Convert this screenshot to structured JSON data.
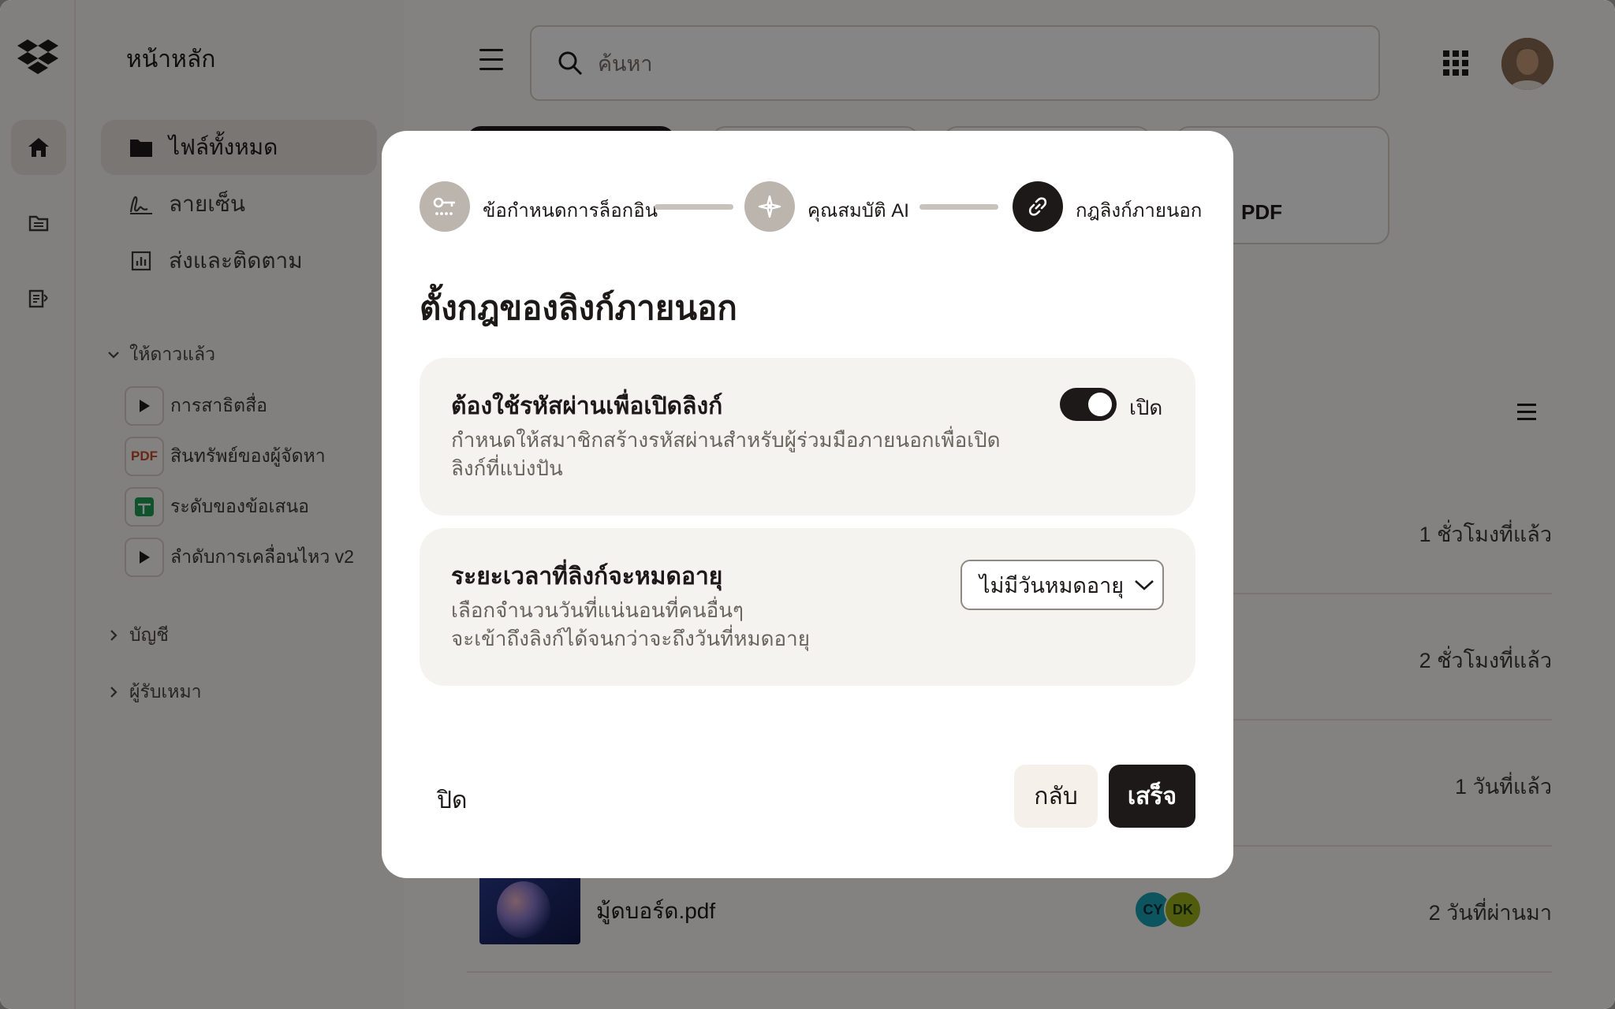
{
  "sidebar": {
    "title": "หน้าหลัก",
    "nav": [
      {
        "label": "ไฟล์ทั้งหมด"
      },
      {
        "label": "ลายเซ็น"
      },
      {
        "label": "ส่งและติดตาม"
      }
    ],
    "starred_heading": "ให้ดาวแล้ว",
    "starred_items": [
      {
        "label": "การสาธิตสื่อ",
        "icon": "play-icon"
      },
      {
        "label": "สินทรัพย์ของผู้จัดหา",
        "icon": "pdf-icon",
        "badge": "PDF"
      },
      {
        "label": "ระดับของข้อเสนอ",
        "icon": "spreadsheet-icon"
      },
      {
        "label": "ลำดับการเคลื่อนไหว v2",
        "icon": "play-icon"
      }
    ],
    "sections": [
      "บัญชี",
      "ผู้รับเหมา"
    ]
  },
  "header": {
    "search_placeholder": "ค้นหา"
  },
  "cards": {
    "pdf_label": "PDF"
  },
  "files": [
    {
      "time": "1 ชั่วโมงที่แล้ว"
    },
    {
      "time": "2 ชั่วโมงที่แล้ว"
    },
    {
      "time": "1 วันที่แล้ว"
    },
    {
      "name": "มู้ดบอร์ด.pdf",
      "time": "2 วันที่ผ่านมา",
      "shared": [
        "CY",
        "DK"
      ]
    }
  ],
  "modal": {
    "steps": [
      {
        "label": "ข้อกำหนดการล็อกอิน",
        "state": "done",
        "icon": "key-icon"
      },
      {
        "label": "คุณสมบัติ AI",
        "state": "done",
        "icon": "ai-sparkle-icon"
      },
      {
        "label": "กฎลิงก์ภายนอก",
        "state": "current",
        "icon": "link-icon"
      }
    ],
    "title": "ตั้งกฎของลิงก์ภายนอก",
    "password_setting": {
      "title": "ต้องใช้รหัสผ่านเพื่อเปิดลิงก์",
      "desc_line1": "กำหนดให้สมาชิกสร้างรหัสผ่านสำหรับผู้ร่วมมือภายนอกเพื่อเปิด",
      "desc_line2": "ลิงก์ที่แบ่งปัน",
      "toggle_state": "เปิด",
      "enabled": true
    },
    "expiry_setting": {
      "title": "ระยะเวลาที่ลิงก์จะหมดอายุ",
      "desc_line1": "เลือกจำนวนวันที่แน่นอนที่คนอื่นๆ",
      "desc_line2": "จะเข้าถึงลิงก์ได้จนกว่าจะถึงวันที่หมดอายุ",
      "selected": "ไม่มีวันหมดอายุ"
    },
    "close_label": "ปิด",
    "back_label": "กลับ",
    "done_label": "เสร็จ"
  },
  "colors": {
    "ink": "#1e1919",
    "surface": "#f5f3ef",
    "step_done": "#bbb5ae",
    "bubble_cy": "#1aa3b4",
    "bubble_dk": "#9cb31a"
  }
}
